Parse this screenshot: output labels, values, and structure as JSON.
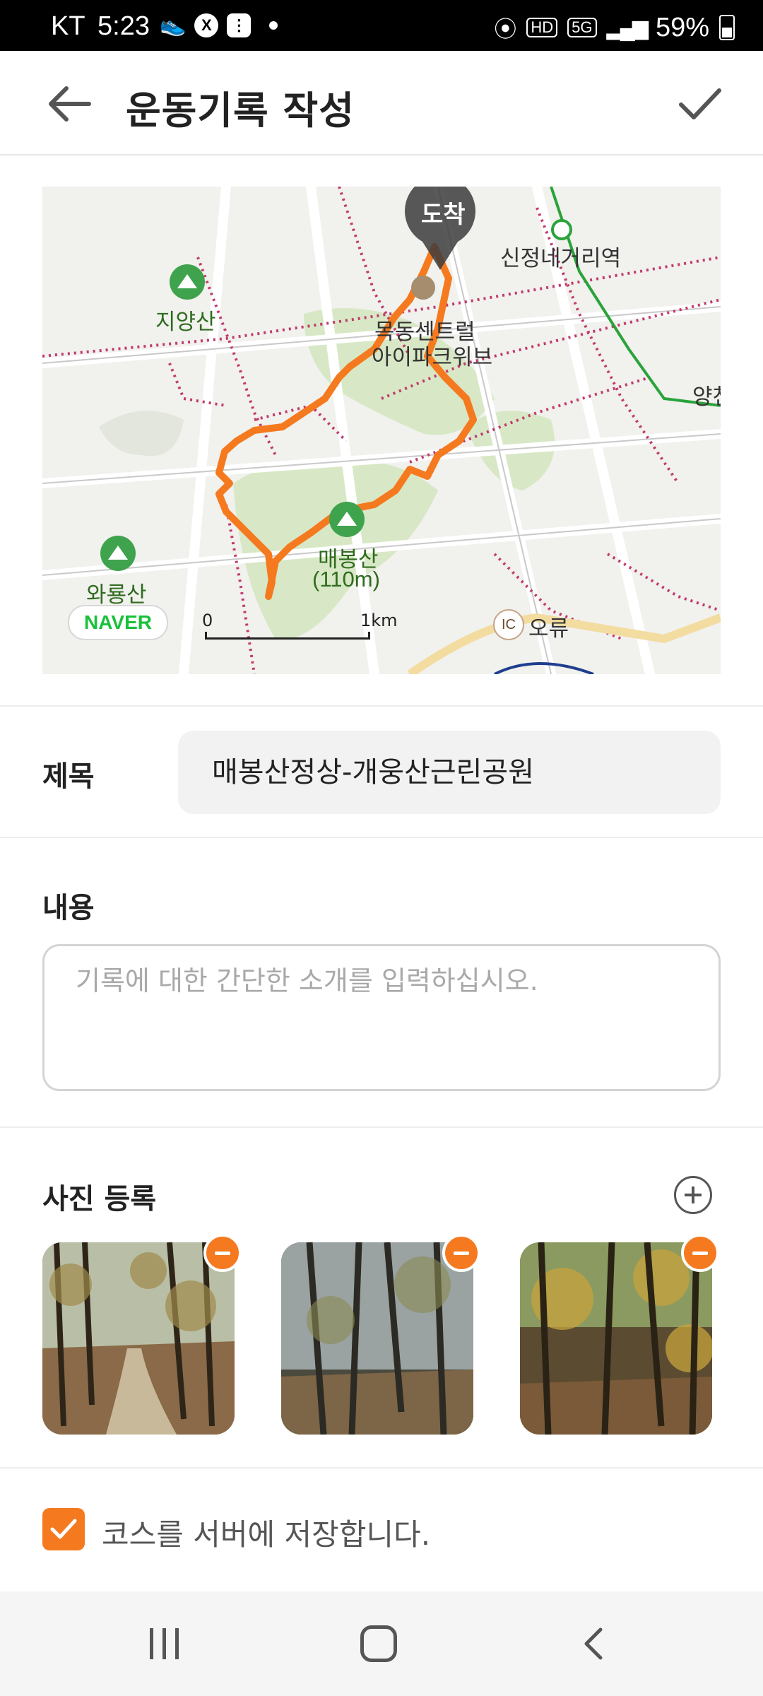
{
  "status_bar": {
    "carrier": "KT",
    "time": "5:23",
    "network": "5G",
    "hd": "HD",
    "battery": "59%"
  },
  "header": {
    "title": "운동기록 작성",
    "back_icon": "arrow-left-icon",
    "confirm_icon": "check-icon"
  },
  "map": {
    "arrival_label": "도착",
    "labels": {
      "jiyangsan": "지양산",
      "sinjeong_station": "신정네거리역",
      "mokdong_park": "목동센트럴",
      "mokdong_park2": "아이파크위브",
      "yangcheon": "양천",
      "maebongsan": "매봉산",
      "maebongsan_height": "(110m)",
      "waryongsan": "와룡산",
      "oryu": "오류",
      "ic": "IC"
    },
    "logo": "NAVER",
    "scale_start": "0",
    "scale_end": "1km",
    "route_color": "#f57a1f"
  },
  "form": {
    "title_label": "제목",
    "title_value": "매봉산정상-개웅산근린공원",
    "content_label": "내용",
    "content_placeholder": "기록에 대한 간단한 소개를 입력하십시오.",
    "photos_label": "사진 등록",
    "photos": [
      {
        "name": "forest-path-photo-1"
      },
      {
        "name": "forest-photo-2"
      },
      {
        "name": "forest-photo-3"
      }
    ],
    "save_course_checked": true,
    "save_course_label": "코스를 서버에 저장합니다."
  },
  "colors": {
    "accent": "#f57a1f",
    "field_bg": "#f2f2f2"
  }
}
